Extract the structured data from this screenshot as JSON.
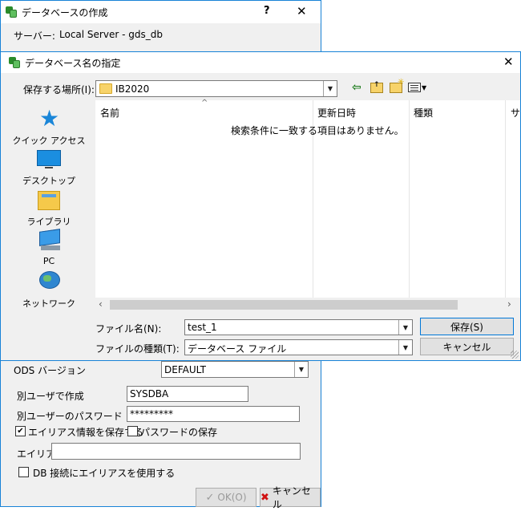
{
  "back_window": {
    "title": "データベースの作成",
    "help_btn": "?",
    "close_btn": "✕",
    "server_label": "サーバー:",
    "server_value": "Local Server - gds_db",
    "ods_label": "ODS バージョン",
    "ods_value": "DEFAULT",
    "alt_user_label": "別ユーザで作成",
    "alt_user_value": "SYSDBA",
    "alt_pw_label": "別ユーザーのパスワード",
    "alt_pw_value": "*********",
    "save_alias_label": "エイリアス情報を保存する",
    "save_alias_checked": true,
    "save_pw_label": "パスワードの保存",
    "save_pw_checked": false,
    "alias_label": "エイリアス",
    "alias_value": "",
    "use_alias_label": "DB 接続にエイリアスを使用する",
    "use_alias_checked": false,
    "ok_label": "OK(O)",
    "cancel_label": "キャンセル"
  },
  "dialog": {
    "title": "データベース名の指定",
    "close_btn": "✕",
    "save_in_label": "保存する場所(I):",
    "save_in_value": "IB2020",
    "nav": [
      {
        "label": "クイック アクセス",
        "icon": "star-icon"
      },
      {
        "label": "デスクトップ",
        "icon": "desktop-icon"
      },
      {
        "label": "ライブラリ",
        "icon": "library-icon"
      },
      {
        "label": "PC",
        "icon": "pc-icon"
      },
      {
        "label": "ネットワーク",
        "icon": "network-icon"
      }
    ],
    "columns": [
      "名前",
      "更新日時",
      "種類",
      "サ"
    ],
    "empty_message": "検索条件に一致する項目はありません。",
    "filename_label": "ファイル名(N):",
    "filename_value": "test_1",
    "filetype_label": "ファイルの種類(T):",
    "filetype_value": "データベース ファイル",
    "save_btn": "保存(S)",
    "cancel_btn": "キャンセル"
  }
}
